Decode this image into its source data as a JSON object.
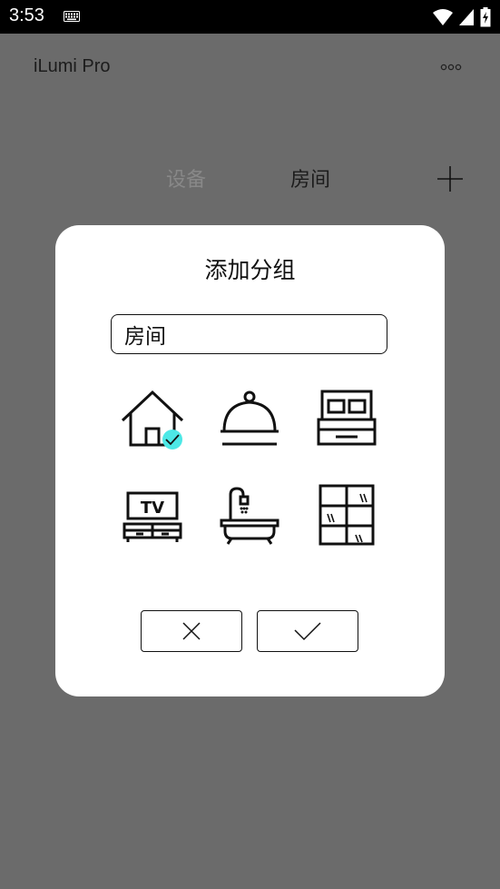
{
  "status": {
    "time": "3:53"
  },
  "app": {
    "title": "iLumi Pro"
  },
  "tabs": [
    {
      "label": "设备"
    },
    {
      "label": "房间"
    }
  ],
  "dialog": {
    "title": "添加分组",
    "input_value": "房间",
    "icons": [
      "house-icon",
      "dining-cloche-icon",
      "bed-icon",
      "tv-cabinet-icon",
      "bathtub-icon",
      "bookshelf-icon"
    ],
    "selected_icon": "house-icon",
    "accent": "#4de8e6"
  }
}
